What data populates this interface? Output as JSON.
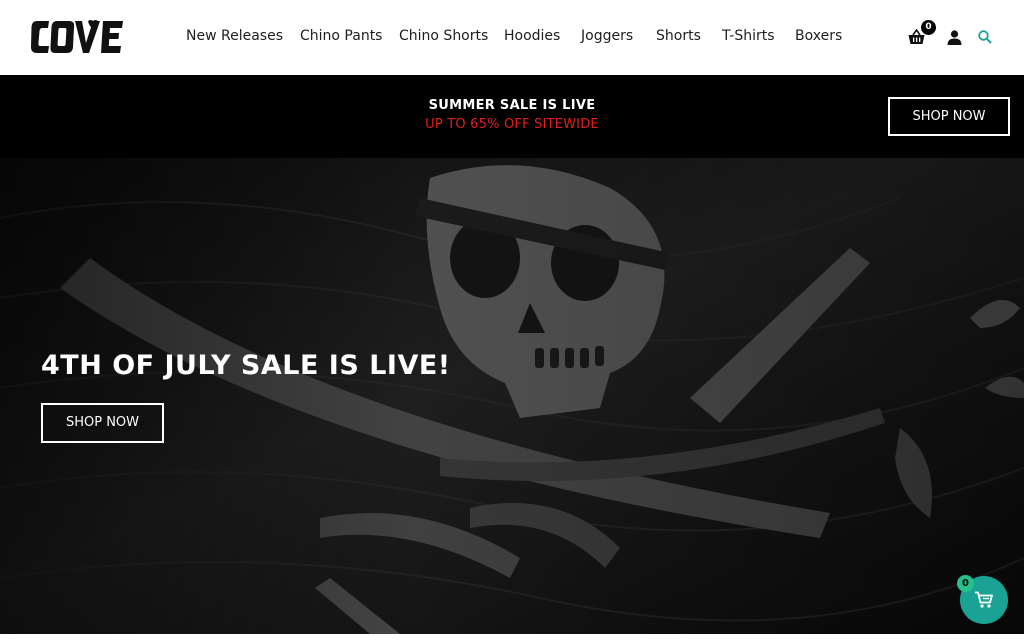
{
  "brand": {
    "logo_text": "COVE",
    "accent_color": "#1aa395"
  },
  "nav": {
    "items": [
      {
        "label": "New Releases"
      },
      {
        "label": "Chino Pants"
      },
      {
        "label": "Chino Shorts"
      },
      {
        "label": "Hoodies"
      },
      {
        "label": "Joggers"
      },
      {
        "label": "Shorts"
      },
      {
        "label": "T-Shirts"
      },
      {
        "label": "Boxers"
      }
    ]
  },
  "header_icons": {
    "cart_icon": "shopping-basket-icon",
    "cart_count": "0",
    "account_icon": "user-icon",
    "search_icon": "search-icon"
  },
  "promo": {
    "title": "SUMMER SALE IS LIVE",
    "subtitle": "UP TO 65% OFF SITEWIDE",
    "button_label": "SHOP NOW",
    "subtitle_color": "#e11d1d"
  },
  "hero": {
    "title": "4TH OF JULY SALE IS LIVE!",
    "button_label": "SHOP NOW"
  },
  "floating_cart": {
    "icon": "cart-icon",
    "count": "0"
  }
}
